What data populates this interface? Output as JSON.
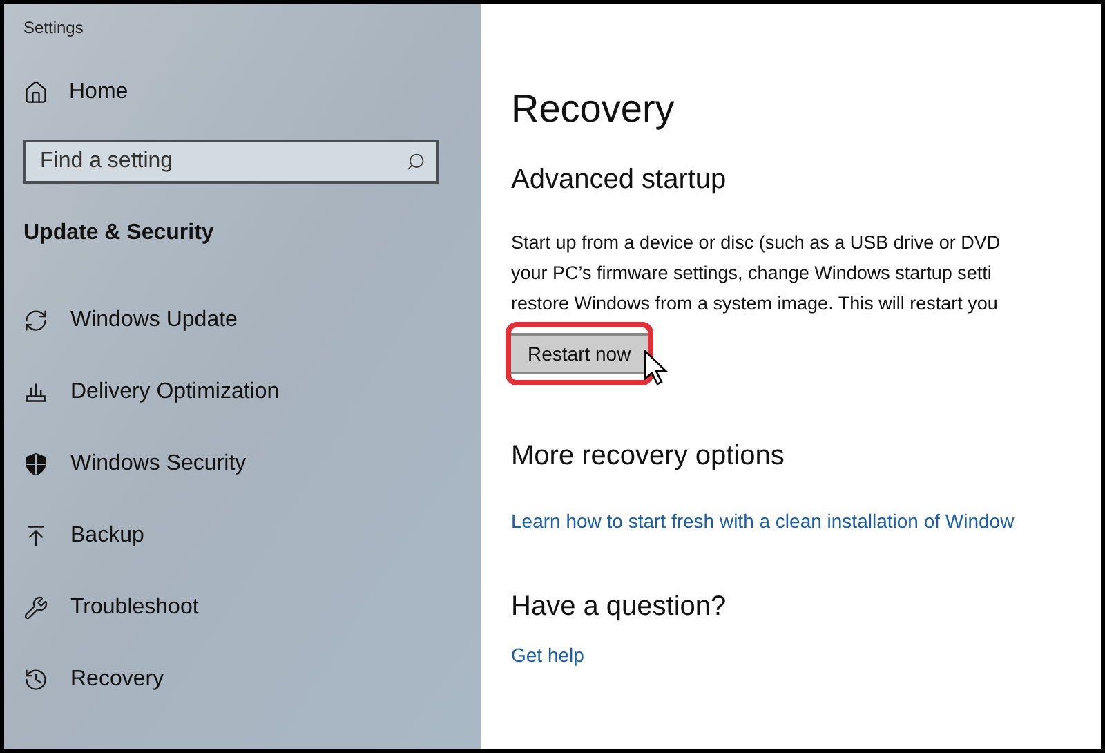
{
  "window": {
    "title": "Settings"
  },
  "sidebar": {
    "home": "Home",
    "search": {
      "placeholder": "Find a setting"
    },
    "section": "Update & Security",
    "items": [
      {
        "label": "Windows Update",
        "kind": "sync"
      },
      {
        "label": "Delivery Optimization",
        "kind": "delivery"
      },
      {
        "label": "Windows Security",
        "kind": "shield"
      },
      {
        "label": "Backup",
        "kind": "backup"
      },
      {
        "label": "Troubleshoot",
        "kind": "wrench"
      },
      {
        "label": "Recovery",
        "kind": "history"
      }
    ]
  },
  "page": {
    "title": "Recovery",
    "advanced_startup": {
      "heading": "Advanced startup",
      "description": [
        "Start up from a device or disc (such as a USB drive or DVD",
        "your PC’s firmware settings, change Windows startup setti",
        "restore Windows from a system image. This will restart you"
      ],
      "button": {
        "label": "Restart now",
        "highlighted": true,
        "hovered": true
      }
    },
    "more_options": {
      "heading": "More recovery options",
      "link": "Learn how to start fresh with a clean installation of Window"
    },
    "question": {
      "heading": "Have a question?",
      "link": "Get help"
    }
  }
}
